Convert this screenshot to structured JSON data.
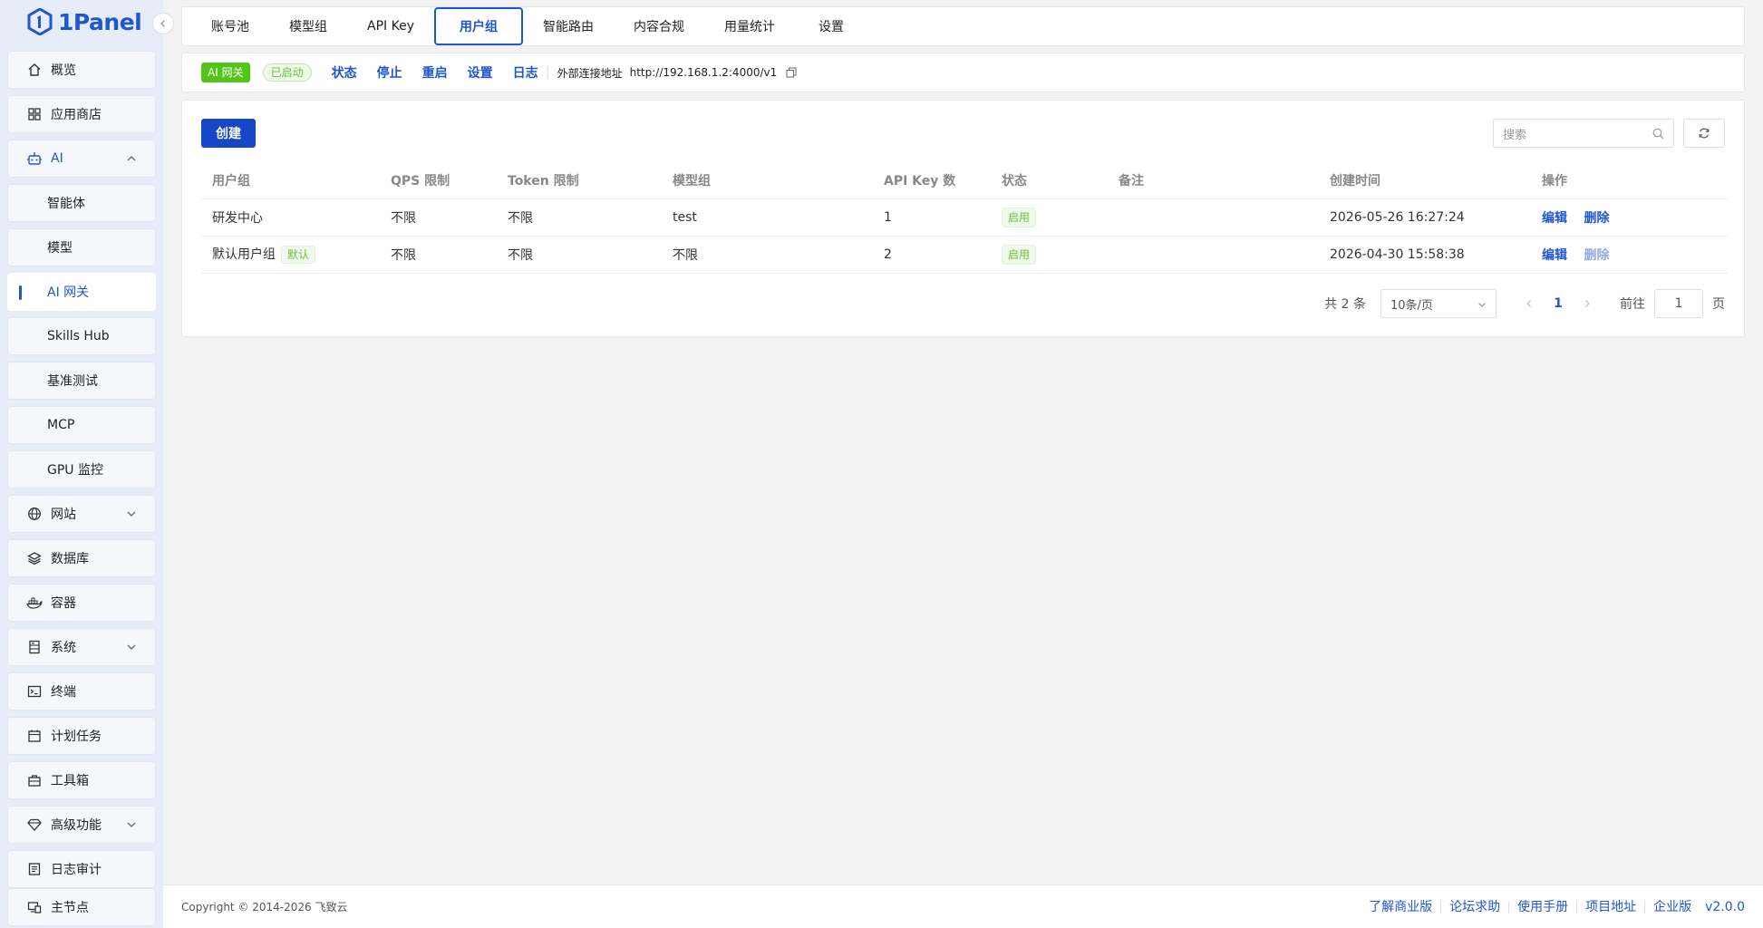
{
  "app": {
    "logo_text": "1Panel"
  },
  "colors": {
    "primary": "#1f56d2",
    "success": "#67c23a",
    "sidebar_bg": "#e7edf8"
  },
  "sidebar": {
    "items": [
      {
        "label": "概览",
        "icon": "home-icon"
      },
      {
        "label": "应用商店",
        "icon": "grid-icon"
      },
      {
        "label": "AI",
        "icon": "robot-icon",
        "expanded": true
      },
      {
        "label": "智能体"
      },
      {
        "label": "模型"
      },
      {
        "label": "AI 网关",
        "active": true
      },
      {
        "label": "Skills Hub"
      },
      {
        "label": "基准测试"
      },
      {
        "label": "MCP"
      },
      {
        "label": "GPU 监控"
      },
      {
        "label": "网站",
        "icon": "globe-icon"
      },
      {
        "label": "数据库",
        "icon": "layers-icon"
      },
      {
        "label": "容器",
        "icon": "docker-icon"
      },
      {
        "label": "系统",
        "icon": "server-icon"
      },
      {
        "label": "终端",
        "icon": "terminal-icon"
      },
      {
        "label": "计划任务",
        "icon": "calendar-icon"
      },
      {
        "label": "工具箱",
        "icon": "toolbox-icon"
      },
      {
        "label": "高级功能",
        "icon": "diamond-icon"
      },
      {
        "label": "日志审计",
        "icon": "log-icon"
      },
      {
        "label": "主节点",
        "icon": "node-icon"
      }
    ]
  },
  "tabs": [
    "账号池",
    "模型组",
    "API Key",
    "用户组",
    "智能路由",
    "内容合规",
    "用量统计",
    "设置"
  ],
  "active_tab": "用户组",
  "status_bar": {
    "app_tag": "AI 网关",
    "state_tag": "已启动",
    "actions": [
      "状态",
      "停止",
      "重启",
      "设置",
      "日志"
    ],
    "url_label": "外部连接地址",
    "url": "http://192.168.1.2:4000/v1"
  },
  "toolbar": {
    "create_label": "创建",
    "search_placeholder": "搜索"
  },
  "table": {
    "columns": [
      "用户组",
      "QPS 限制",
      "Token 限制",
      "模型组",
      "API Key 数",
      "状态",
      "备注",
      "创建时间",
      "操作"
    ],
    "rows": [
      {
        "name": "研发中心",
        "default_tag": "",
        "qps": "不限",
        "token": "不限",
        "model_group": "test",
        "api_keys": "1",
        "status": "启用",
        "note": "",
        "created": "2026-05-26 16:27:24",
        "edit": "编辑",
        "delete": "删除"
      },
      {
        "name": "默认用户组",
        "default_tag": "默认",
        "qps": "不限",
        "token": "不限",
        "model_group": "不限",
        "api_keys": "2",
        "status": "启用",
        "note": "",
        "created": "2026-04-30 15:58:38",
        "edit": "编辑",
        "delete": "删除"
      }
    ]
  },
  "pagination": {
    "total": "共 2 条",
    "page_size": "10条/页",
    "current_page": "1",
    "goto_label": "前往",
    "goto_value": "1",
    "page_unit": "页"
  },
  "footer": {
    "copyright": "Copyright © 2014-2026 飞致云",
    "links": [
      "了解商业版",
      "论坛求助",
      "使用手册",
      "项目地址",
      "企业版"
    ],
    "version": "v2.0.0"
  }
}
